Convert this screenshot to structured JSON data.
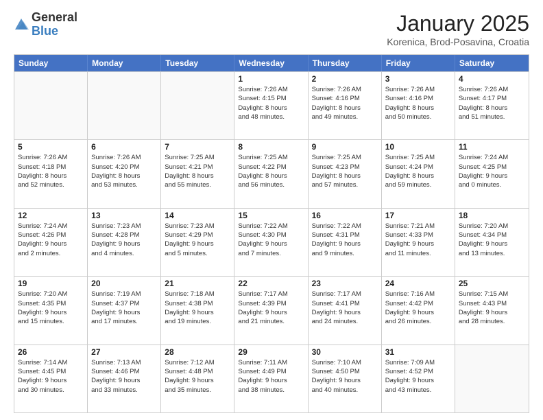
{
  "logo": {
    "general": "General",
    "blue": "Blue"
  },
  "title": "January 2025",
  "location": "Korenica, Brod-Posavina, Croatia",
  "days": [
    "Sunday",
    "Monday",
    "Tuesday",
    "Wednesday",
    "Thursday",
    "Friday",
    "Saturday"
  ],
  "weeks": [
    [
      {
        "day": "",
        "content": ""
      },
      {
        "day": "",
        "content": ""
      },
      {
        "day": "",
        "content": ""
      },
      {
        "day": "1",
        "content": "Sunrise: 7:26 AM\nSunset: 4:15 PM\nDaylight: 8 hours\nand 48 minutes."
      },
      {
        "day": "2",
        "content": "Sunrise: 7:26 AM\nSunset: 4:16 PM\nDaylight: 8 hours\nand 49 minutes."
      },
      {
        "day": "3",
        "content": "Sunrise: 7:26 AM\nSunset: 4:16 PM\nDaylight: 8 hours\nand 50 minutes."
      },
      {
        "day": "4",
        "content": "Sunrise: 7:26 AM\nSunset: 4:17 PM\nDaylight: 8 hours\nand 51 minutes."
      }
    ],
    [
      {
        "day": "5",
        "content": "Sunrise: 7:26 AM\nSunset: 4:18 PM\nDaylight: 8 hours\nand 52 minutes."
      },
      {
        "day": "6",
        "content": "Sunrise: 7:26 AM\nSunset: 4:20 PM\nDaylight: 8 hours\nand 53 minutes."
      },
      {
        "day": "7",
        "content": "Sunrise: 7:25 AM\nSunset: 4:21 PM\nDaylight: 8 hours\nand 55 minutes."
      },
      {
        "day": "8",
        "content": "Sunrise: 7:25 AM\nSunset: 4:22 PM\nDaylight: 8 hours\nand 56 minutes."
      },
      {
        "day": "9",
        "content": "Sunrise: 7:25 AM\nSunset: 4:23 PM\nDaylight: 8 hours\nand 57 minutes."
      },
      {
        "day": "10",
        "content": "Sunrise: 7:25 AM\nSunset: 4:24 PM\nDaylight: 8 hours\nand 59 minutes."
      },
      {
        "day": "11",
        "content": "Sunrise: 7:24 AM\nSunset: 4:25 PM\nDaylight: 9 hours\nand 0 minutes."
      }
    ],
    [
      {
        "day": "12",
        "content": "Sunrise: 7:24 AM\nSunset: 4:26 PM\nDaylight: 9 hours\nand 2 minutes."
      },
      {
        "day": "13",
        "content": "Sunrise: 7:23 AM\nSunset: 4:28 PM\nDaylight: 9 hours\nand 4 minutes."
      },
      {
        "day": "14",
        "content": "Sunrise: 7:23 AM\nSunset: 4:29 PM\nDaylight: 9 hours\nand 5 minutes."
      },
      {
        "day": "15",
        "content": "Sunrise: 7:22 AM\nSunset: 4:30 PM\nDaylight: 9 hours\nand 7 minutes."
      },
      {
        "day": "16",
        "content": "Sunrise: 7:22 AM\nSunset: 4:31 PM\nDaylight: 9 hours\nand 9 minutes."
      },
      {
        "day": "17",
        "content": "Sunrise: 7:21 AM\nSunset: 4:33 PM\nDaylight: 9 hours\nand 11 minutes."
      },
      {
        "day": "18",
        "content": "Sunrise: 7:20 AM\nSunset: 4:34 PM\nDaylight: 9 hours\nand 13 minutes."
      }
    ],
    [
      {
        "day": "19",
        "content": "Sunrise: 7:20 AM\nSunset: 4:35 PM\nDaylight: 9 hours\nand 15 minutes."
      },
      {
        "day": "20",
        "content": "Sunrise: 7:19 AM\nSunset: 4:37 PM\nDaylight: 9 hours\nand 17 minutes."
      },
      {
        "day": "21",
        "content": "Sunrise: 7:18 AM\nSunset: 4:38 PM\nDaylight: 9 hours\nand 19 minutes."
      },
      {
        "day": "22",
        "content": "Sunrise: 7:17 AM\nSunset: 4:39 PM\nDaylight: 9 hours\nand 21 minutes."
      },
      {
        "day": "23",
        "content": "Sunrise: 7:17 AM\nSunset: 4:41 PM\nDaylight: 9 hours\nand 24 minutes."
      },
      {
        "day": "24",
        "content": "Sunrise: 7:16 AM\nSunset: 4:42 PM\nDaylight: 9 hours\nand 26 minutes."
      },
      {
        "day": "25",
        "content": "Sunrise: 7:15 AM\nSunset: 4:43 PM\nDaylight: 9 hours\nand 28 minutes."
      }
    ],
    [
      {
        "day": "26",
        "content": "Sunrise: 7:14 AM\nSunset: 4:45 PM\nDaylight: 9 hours\nand 30 minutes."
      },
      {
        "day": "27",
        "content": "Sunrise: 7:13 AM\nSunset: 4:46 PM\nDaylight: 9 hours\nand 33 minutes."
      },
      {
        "day": "28",
        "content": "Sunrise: 7:12 AM\nSunset: 4:48 PM\nDaylight: 9 hours\nand 35 minutes."
      },
      {
        "day": "29",
        "content": "Sunrise: 7:11 AM\nSunset: 4:49 PM\nDaylight: 9 hours\nand 38 minutes."
      },
      {
        "day": "30",
        "content": "Sunrise: 7:10 AM\nSunset: 4:50 PM\nDaylight: 9 hours\nand 40 minutes."
      },
      {
        "day": "31",
        "content": "Sunrise: 7:09 AM\nSunset: 4:52 PM\nDaylight: 9 hours\nand 43 minutes."
      },
      {
        "day": "",
        "content": ""
      }
    ]
  ]
}
